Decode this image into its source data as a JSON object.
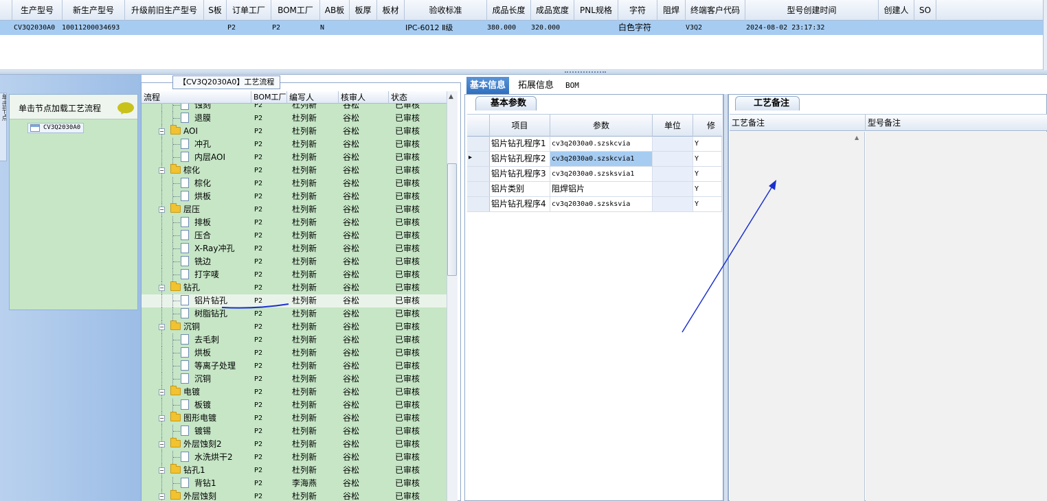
{
  "top_grid": {
    "columns": [
      "生产型号",
      "新生产型号",
      "升级前旧生产型号",
      "S板",
      "订单工厂",
      "BOM工厂",
      "AB板",
      "板厚",
      "板材",
      "验收标准",
      "成品长度",
      "成品宽度",
      "PNL规格",
      "字符",
      "阻焊",
      "终端客户代码",
      "型号创建时间",
      "创建人",
      "SO"
    ],
    "row": [
      "CV3Q2030A0",
      "10011200034693",
      "",
      "",
      "P2",
      "P2",
      "N",
      "",
      "",
      "IPC-6012 Ⅱ级",
      "380.000",
      "320.000",
      "",
      "白色字符",
      "",
      "V3Q2",
      "2024-08-02 23:17:32",
      "",
      ""
    ]
  },
  "left_panel": {
    "vertical_tab": "单击节点",
    "load_label": "单击节点加载工艺流程",
    "tree_root": "CV3Q2030A0"
  },
  "process_panel": {
    "title": "【CV3Q2030A0】工艺流程",
    "columns": [
      "流程",
      "BOM工厂",
      "编写人",
      "核审人",
      "状态"
    ],
    "rows": [
      {
        "name": "蚀刻",
        "level": 2,
        "factory": "P2",
        "writer": "杜列新",
        "reviewer": "谷松",
        "status": "已审核"
      },
      {
        "name": "退膜",
        "level": 2,
        "factory": "P2",
        "writer": "杜列新",
        "reviewer": "谷松",
        "status": "已审核"
      },
      {
        "name": "AOI",
        "level": 1,
        "factory": "P2",
        "writer": "杜列新",
        "reviewer": "谷松",
        "status": "已审核"
      },
      {
        "name": "冲孔",
        "level": 2,
        "factory": "P2",
        "writer": "杜列新",
        "reviewer": "谷松",
        "status": "已审核"
      },
      {
        "name": "内层AOI",
        "level": 2,
        "factory": "P2",
        "writer": "杜列新",
        "reviewer": "谷松",
        "status": "已审核"
      },
      {
        "name": "棕化",
        "level": 1,
        "factory": "P2",
        "writer": "杜列新",
        "reviewer": "谷松",
        "status": "已审核"
      },
      {
        "name": "棕化",
        "level": 2,
        "factory": "P2",
        "writer": "杜列新",
        "reviewer": "谷松",
        "status": "已审核"
      },
      {
        "name": "烘板",
        "level": 2,
        "factory": "P2",
        "writer": "杜列新",
        "reviewer": "谷松",
        "status": "已审核"
      },
      {
        "name": "层压",
        "level": 1,
        "factory": "P2",
        "writer": "杜列新",
        "reviewer": "谷松",
        "status": "已审核"
      },
      {
        "name": "排板",
        "level": 2,
        "factory": "P2",
        "writer": "杜列新",
        "reviewer": "谷松",
        "status": "已审核"
      },
      {
        "name": "压合",
        "level": 2,
        "factory": "P2",
        "writer": "杜列新",
        "reviewer": "谷松",
        "status": "已审核"
      },
      {
        "name": "X-Ray冲孔",
        "level": 2,
        "factory": "P2",
        "writer": "杜列新",
        "reviewer": "谷松",
        "status": "已审核"
      },
      {
        "name": "铣边",
        "level": 2,
        "factory": "P2",
        "writer": "杜列新",
        "reviewer": "谷松",
        "status": "已审核"
      },
      {
        "name": "打字唛",
        "level": 2,
        "factory": "P2",
        "writer": "杜列新",
        "reviewer": "谷松",
        "status": "已审核"
      },
      {
        "name": "钻孔",
        "level": 1,
        "factory": "P2",
        "writer": "杜列新",
        "reviewer": "谷松",
        "status": "已审核"
      },
      {
        "name": "铝片钻孔",
        "level": 2,
        "factory": "P2",
        "writer": "杜列新",
        "reviewer": "谷松",
        "status": "已审核",
        "selected": true
      },
      {
        "name": "树脂钻孔",
        "level": 2,
        "factory": "P2",
        "writer": "杜列新",
        "reviewer": "谷松",
        "status": "已审核"
      },
      {
        "name": "沉铜",
        "level": 1,
        "factory": "P2",
        "writer": "杜列新",
        "reviewer": "谷松",
        "status": "已审核"
      },
      {
        "name": "去毛刺",
        "level": 2,
        "factory": "P2",
        "writer": "杜列新",
        "reviewer": "谷松",
        "status": "已审核"
      },
      {
        "name": "烘板",
        "level": 2,
        "factory": "P2",
        "writer": "杜列新",
        "reviewer": "谷松",
        "status": "已审核"
      },
      {
        "name": "等离子处理",
        "level": 2,
        "factory": "P2",
        "writer": "杜列新",
        "reviewer": "谷松",
        "status": "已审核"
      },
      {
        "name": "沉铜",
        "level": 2,
        "factory": "P2",
        "writer": "杜列新",
        "reviewer": "谷松",
        "status": "已审核"
      },
      {
        "name": "电镀",
        "level": 1,
        "factory": "P2",
        "writer": "杜列新",
        "reviewer": "谷松",
        "status": "已审核"
      },
      {
        "name": "板镀",
        "level": 2,
        "factory": "P2",
        "writer": "杜列新",
        "reviewer": "谷松",
        "status": "已审核"
      },
      {
        "name": "图形电镀",
        "level": 1,
        "factory": "P2",
        "writer": "杜列新",
        "reviewer": "谷松",
        "status": "已审核"
      },
      {
        "name": "镀锡",
        "level": 2,
        "factory": "P2",
        "writer": "杜列新",
        "reviewer": "谷松",
        "status": "已审核"
      },
      {
        "name": "外层蚀刻2",
        "level": 1,
        "factory": "P2",
        "writer": "杜列新",
        "reviewer": "谷松",
        "status": "已审核"
      },
      {
        "name": "水洗烘干2",
        "level": 2,
        "factory": "P2",
        "writer": "杜列新",
        "reviewer": "谷松",
        "status": "已审核"
      },
      {
        "name": "钻孔1",
        "level": 1,
        "factory": "P2",
        "writer": "杜列新",
        "reviewer": "谷松",
        "status": "已审核"
      },
      {
        "name": "背钻1",
        "level": 2,
        "factory": "P2",
        "writer": "李海燕",
        "reviewer": "谷松",
        "status": "已审核"
      },
      {
        "name": "外层蚀刻",
        "level": 1,
        "factory": "P2",
        "writer": "杜列新",
        "reviewer": "谷松",
        "status": "已审核"
      }
    ]
  },
  "tabs": [
    "基本信息",
    "拓展信息",
    "BOM"
  ],
  "basic_params": {
    "tab_label": "基本参数",
    "columns": [
      "项目",
      "参数",
      "单位",
      "修改"
    ],
    "rows": [
      {
        "item": "铝片钻孔程序1",
        "param": "cv3q2030a0.szskcvia",
        "unit": "",
        "modify": "Y"
      },
      {
        "item": "铝片钻孔程序2",
        "param": "cv3q2030a0.szskcvia1",
        "unit": "",
        "modify": "Y",
        "current": true
      },
      {
        "item": "铝片钻孔程序3",
        "param": "cv3q2030a0.szsksvia1",
        "unit": "",
        "modify": "Y"
      },
      {
        "item": "铝片类别",
        "param": "阻焊铝片",
        "unit": "",
        "modify": "Y"
      },
      {
        "item": "铝片钻孔程序4",
        "param": "cv3q2030a0.szsksvia",
        "unit": "",
        "modify": "Y"
      }
    ]
  },
  "remarks": {
    "tab_label": "工艺备注",
    "columns": [
      "工艺备注",
      "型号备注"
    ]
  },
  "colors": {
    "selection_blue": "#a6ccf2",
    "tree_green": "#c6e6c6",
    "tab_active": "#2f6fbf",
    "annotation_stroke": "#1a2fcf"
  }
}
